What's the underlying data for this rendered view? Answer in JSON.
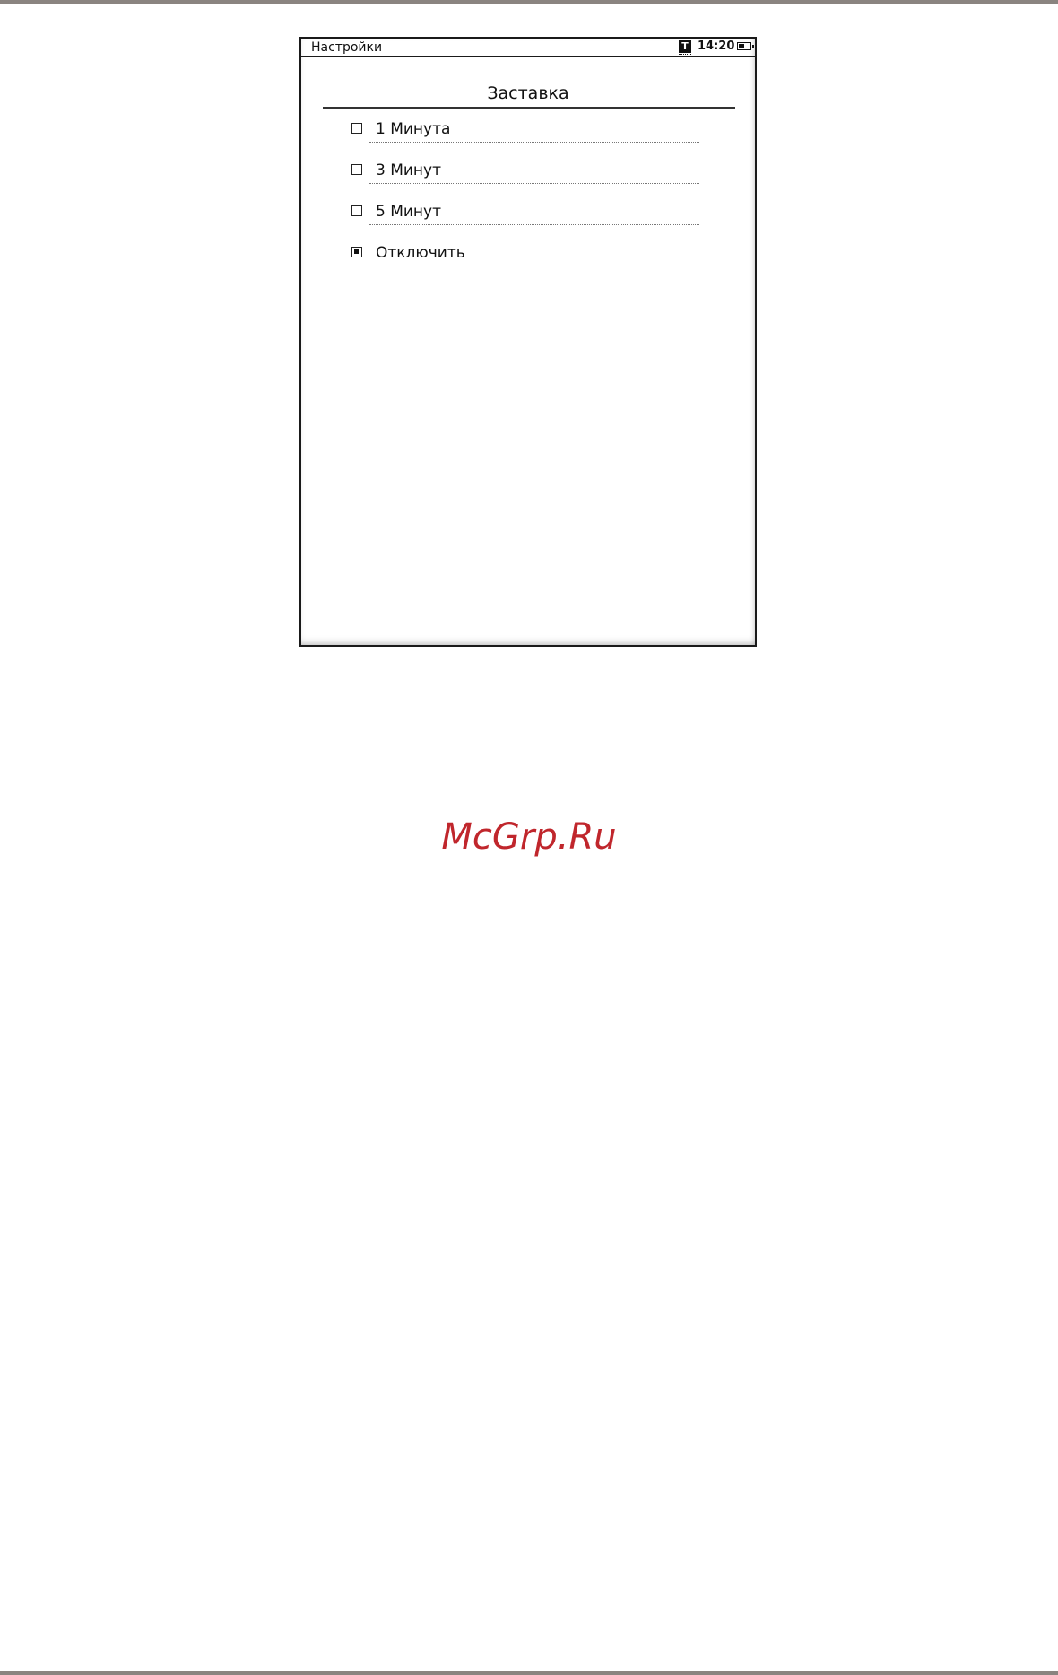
{
  "status_bar": {
    "title": "Настройки",
    "mode_icon_letter": "T",
    "time": "14:20",
    "battery_icon": "battery-low-icon"
  },
  "screen": {
    "title": "Заставка",
    "options": [
      {
        "label": "1 Минута",
        "checked": false
      },
      {
        "label": "3 Минут",
        "checked": false
      },
      {
        "label": "5 Минут",
        "checked": false
      },
      {
        "label": "Отключить",
        "checked": true
      }
    ]
  },
  "watermark": {
    "text": "McGrp.Ru",
    "color": "#c0262c"
  }
}
